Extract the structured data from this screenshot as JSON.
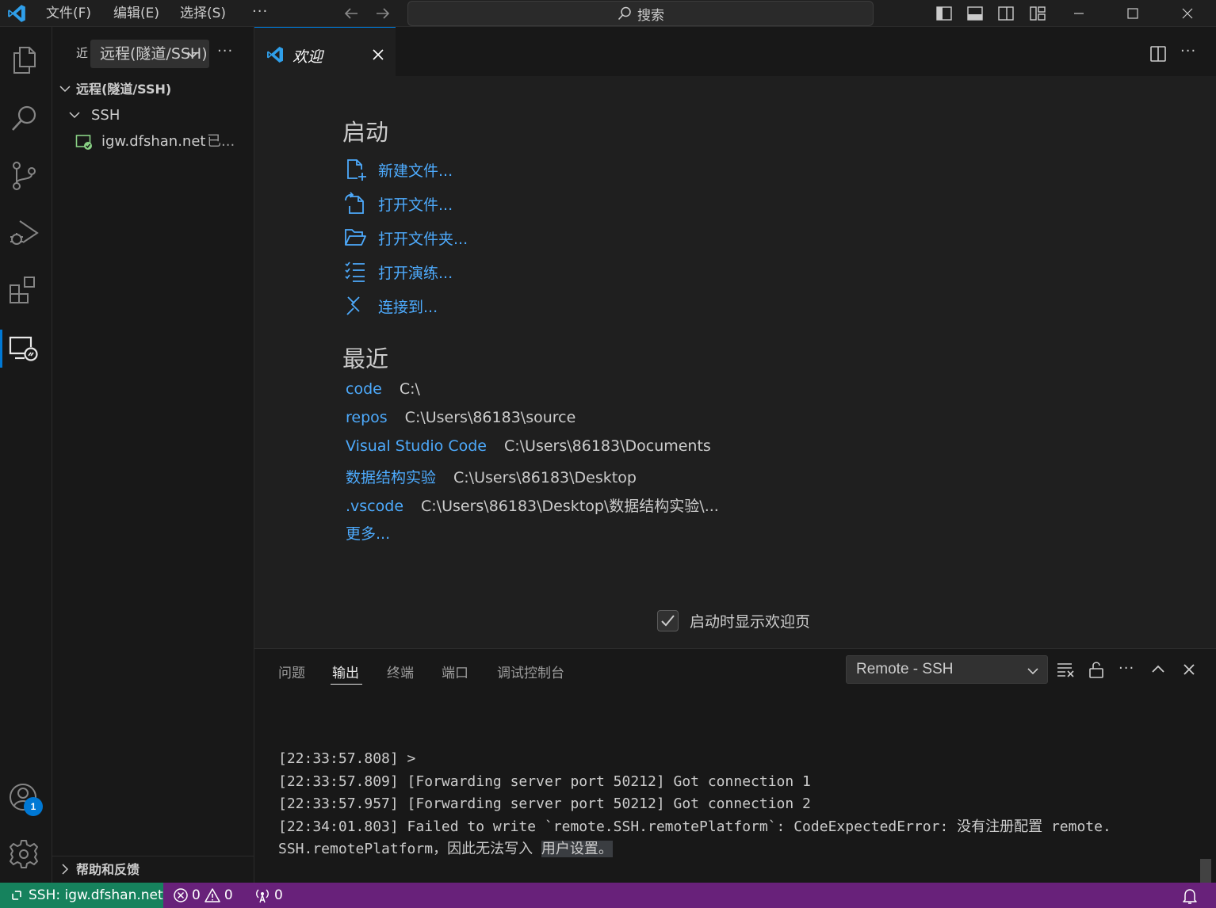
{
  "titlebar": {
    "menu": [
      "文件(F)",
      "编辑(E)",
      "选择(S)"
    ],
    "more": "···",
    "search_placeholder": "搜索"
  },
  "activity_bar": {
    "items": [
      "explorer-icon",
      "search-icon",
      "source-control-icon",
      "run-debug-icon",
      "extensions-icon",
      "remote-explorer-icon"
    ],
    "account_badge": "1"
  },
  "sidebar": {
    "header_label": "近",
    "dropdown_value": "远程(隧道/SSH)",
    "more": "···",
    "section_title": "远程(隧道/SSH)",
    "group": "SSH",
    "host": "igw.dfshan.net",
    "host_status": "已...",
    "help_section": "帮助和反馈"
  },
  "editor": {
    "tab_label": "欢迎",
    "more": "···",
    "start_title": "启动",
    "start_items": [
      {
        "label": "新建文件...",
        "icon": "new-file-icon"
      },
      {
        "label": "打开文件...",
        "icon": "open-file-icon"
      },
      {
        "label": "打开文件夹...",
        "icon": "open-folder-icon"
      },
      {
        "label": "打开演练...",
        "icon": "walkthrough-icon"
      },
      {
        "label": "连接到...",
        "icon": "remote-connect-icon"
      }
    ],
    "recent_title": "最近",
    "recent": [
      {
        "name": "code",
        "path": "C:\\"
      },
      {
        "name": "repos",
        "path": "C:\\Users\\86183\\source"
      },
      {
        "name": "Visual Studio Code",
        "path": "C:\\Users\\86183\\Documents"
      },
      {
        "name": "数据结构实验",
        "path": "C:\\Users\\86183\\Desktop"
      },
      {
        "name": ".vscode",
        "path": "C:\\Users\\86183\\Desktop\\数据结构实验\\..."
      }
    ],
    "recent_more": "更多...",
    "show_on_startup_label": "启动时显示欢迎页",
    "show_on_startup_checked": true
  },
  "panel": {
    "tabs": [
      "问题",
      "输出",
      "终端",
      "端口",
      "调试控制台"
    ],
    "active_tab": "输出",
    "output_channel": "Remote - SSH",
    "more": "···",
    "log": [
      "[22:33:57.808] >",
      "[22:33:57.809] [Forwarding server port 50212] Got connection 1",
      "[22:33:57.957] [Forwarding server port 50212] Got connection 2",
      "[22:34:01.803] Failed to write `remote.SSH.remotePlatform`: CodeExpectedError: 没有注册配置 remote."
    ],
    "log_last_prefix": "SSH.remotePlatform，因此无法写入 ",
    "log_last_highlight": "用户设置。"
  },
  "statusbar": {
    "remote": "SSH: igw.dfshan.net",
    "errors": "0",
    "warnings": "0",
    "ports": "0"
  },
  "colors": {
    "accent": "#0078d4",
    "link": "#4daafc",
    "statusbar": "#68217a",
    "remote_indicator": "#16825d"
  }
}
